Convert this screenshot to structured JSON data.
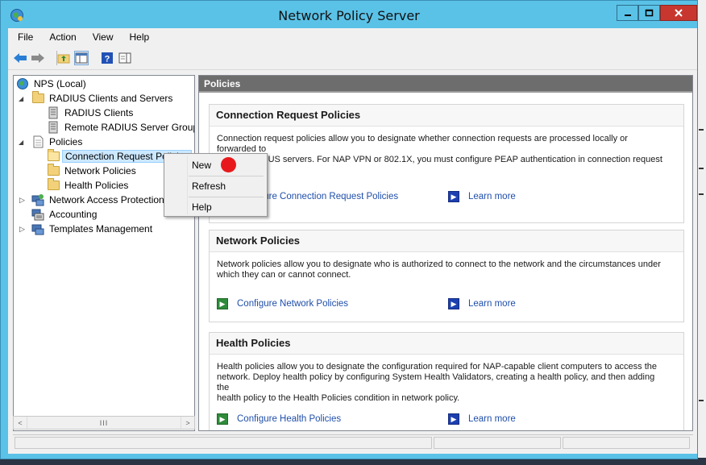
{
  "window": {
    "title": "Network Policy Server"
  },
  "menu": [
    "File",
    "Action",
    "View",
    "Help"
  ],
  "tree": {
    "root": "NPS (Local)",
    "radius_clients_and_servers": "RADIUS Clients and Servers",
    "radius_clients": "RADIUS Clients",
    "remote_radius_server_groups": "Remote RADIUS Server Groups",
    "policies": "Policies",
    "connection_request_policies": "Connection Request Policies",
    "network_policies": "Network Policies",
    "health_policies": "Health Policies",
    "network_access_protection": "Network Access Protection",
    "accounting": "Accounting",
    "templates_management": "Templates Management"
  },
  "context_menu": {
    "new": "New",
    "refresh": "Refresh",
    "help": "Help"
  },
  "content": {
    "header": "Policies",
    "sections": [
      {
        "title": "Connection Request Policies",
        "desc_line1": "Connection request policies allow you to designate whether connection requests are processed locally or forwarded to",
        "desc_line2": "remote RADIUS servers. For NAP VPN or 802.1X, you must configure PEAP authentication in connection request",
        "configure_link": "Configure Connection Request Policies",
        "learn_more": "Learn more"
      },
      {
        "title": "Network Policies",
        "desc_line1": "Network policies allow you to designate who is authorized to connect to the network and the circumstances under",
        "desc_line2": "which they can or cannot connect.",
        "configure_link": "Configure Network Policies",
        "learn_more": "Learn more"
      },
      {
        "title": "Health Policies",
        "desc_line1": "Health policies allow you to designate the configuration required for NAP-capable client computers to access the",
        "desc_line2": "network. Deploy health policy by configuring System Health Validators, creating a health policy, and then adding the",
        "desc_line3": "health policy to the Health Policies condition in network policy.",
        "configure_link": "Configure Health Policies",
        "learn_more": "Learn more"
      }
    ]
  },
  "colors": {
    "titlebar": "#5bc2e7",
    "close_button": "#c7372f",
    "link": "#1f4eaa",
    "annotation_dot": "#e8191c"
  }
}
